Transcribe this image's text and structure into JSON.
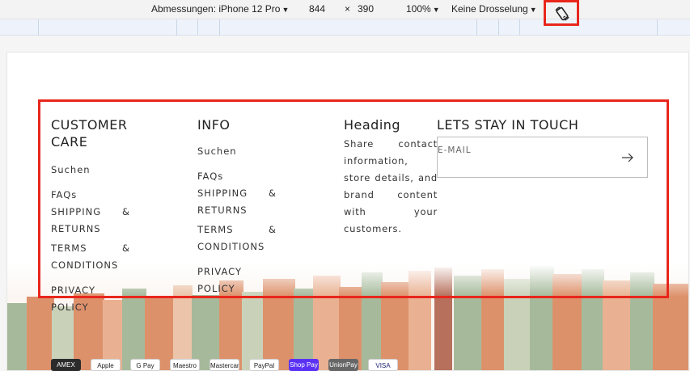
{
  "devtools": {
    "dimensions_label": "Abmessungen: iPhone 12 Pro",
    "width": "844",
    "times": "×",
    "height": "390",
    "zoom": "100%",
    "throttle": "Keine Drosselung",
    "rotate_icon": "rotate-device-icon",
    "highlight_color": "#e8261c"
  },
  "footer": {
    "customer_care": {
      "heading": "CUSTOMER CARE",
      "links": [
        "Suchen",
        "FAQs",
        "SHIPPING & RETURNS",
        "TERMS & CONDITIONS",
        "PRIVACY POLICY"
      ]
    },
    "info": {
      "heading": "INFO",
      "links": [
        "Suchen",
        "FAQs",
        "SHIPPING & RETURNS",
        "TERMS & CONDITIONS",
        "PRIVACY POLICY"
      ]
    },
    "heading_col": {
      "heading": "Heading",
      "text": "Share contact information, store details, and brand content with your customers."
    },
    "newsletter": {
      "heading": "LETS STAY IN TOUCH",
      "placeholder": "E-MAIL",
      "submit_icon": "arrow-right-icon"
    }
  },
  "payments": [
    "AMEX",
    "Apple Pay",
    "G Pay",
    "Maestro",
    "Mastercard",
    "PayPal",
    "Shop Pay",
    "UnionPay",
    "VISA"
  ],
  "colors": {
    "green": "#8aa77e",
    "orange": "#d3703f",
    "brown": "#a0442a"
  }
}
